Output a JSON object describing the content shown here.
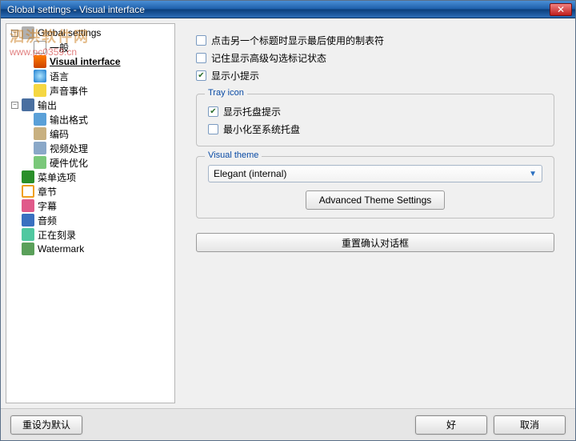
{
  "title": "Global settings - Visual interface",
  "watermark": {
    "line1": "泗洪软件网",
    "line2": "www.pc0359.cn"
  },
  "tree": {
    "parent1": "Global settings",
    "i_general": "一般",
    "i_visual": "Visual interface",
    "i_lang": "语言",
    "i_sound": "声音事件",
    "parent2": "输出",
    "i_outfmt": "输出格式",
    "i_encode": "编码",
    "i_vproc": "视频处理",
    "i_hw": "硬件优化",
    "i_menu": "菜单选项",
    "i_chap": "章节",
    "i_sub": "字幕",
    "i_audio": "音频",
    "i_burn": "正在刻录",
    "i_wm": "Watermark"
  },
  "checks": {
    "c1": "点击另一个标题时显示最后使用的制表符",
    "c2": "记住显示高级勾选标记状态",
    "c3": "显示小提示"
  },
  "tray": {
    "legend": "Tray icon",
    "t1": "显示托盘提示",
    "t2": "最小化至系统托盘"
  },
  "theme": {
    "legend": "Visual theme",
    "selected": "Elegant (internal)",
    "advbtn": "Advanced Theme Settings"
  },
  "resetconfirm": "重置确认对话框",
  "footer": {
    "defaults": "重设为默认",
    "ok": "好",
    "cancel": "取消"
  }
}
